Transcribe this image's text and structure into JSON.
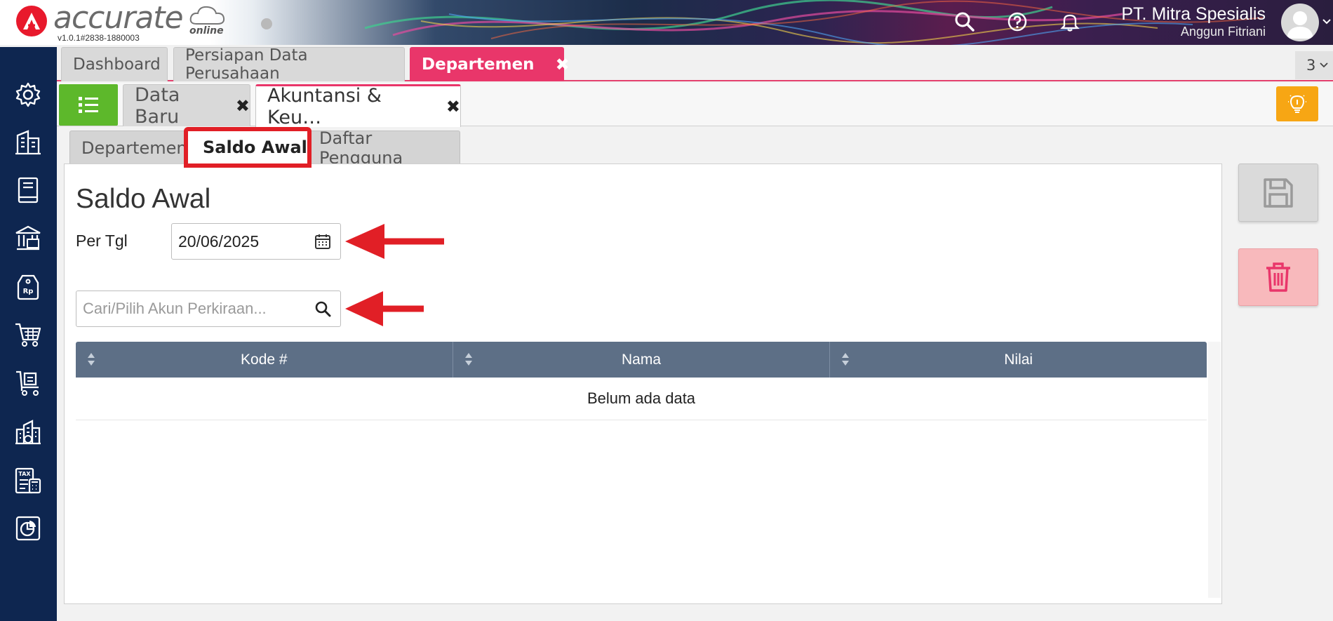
{
  "app": {
    "logo_text": "accurate",
    "logo_sub": "online",
    "version": "v1.0.1#2838-1880003"
  },
  "header": {
    "company_name": "PT. Mitra Spesialis",
    "user_name": "Anggun Fitriani",
    "icons": [
      "search-icon",
      "help-icon",
      "bell-icon"
    ]
  },
  "sidebar": {
    "items": [
      "settings-icon",
      "company-icon",
      "ledger-book-icon",
      "bank-icon",
      "price-tag-icon",
      "cart-icon",
      "purchase-cart-icon",
      "warehouse-icon",
      "tax-calculator-icon",
      "report-icon"
    ]
  },
  "tabs_top": [
    {
      "label": "Dashboard"
    },
    {
      "label": "Persiapan Data Perusahaan"
    },
    {
      "label": "Departemen",
      "close": "✖",
      "active": true
    }
  ],
  "tab_count": "3",
  "tabs_second": [
    {
      "label": "Data Baru",
      "close": "✖"
    },
    {
      "label": "Akuntansi & Keu…",
      "close": "✖",
      "active": true
    }
  ],
  "tabs_form": [
    {
      "label": "Departemen"
    },
    {
      "label": "Saldo Awal",
      "active": true
    },
    {
      "label": "Daftar Pengguna"
    }
  ],
  "form": {
    "title": "Saldo Awal",
    "date_label": "Per Tgl",
    "date_value": "20/06/2025",
    "search_placeholder": "Cari/Pilih Akun Perkiraan..."
  },
  "table": {
    "columns": [
      "Kode #",
      "Nama",
      "Nilai"
    ],
    "empty_text": "Belum ada data"
  },
  "colors": {
    "sidebar": "#0e2650",
    "accent": "#e9366a",
    "list_button": "#5db82b",
    "bulb_button": "#f7a614",
    "table_header": "#5d6f86",
    "annotation_red": "#e11f26"
  }
}
